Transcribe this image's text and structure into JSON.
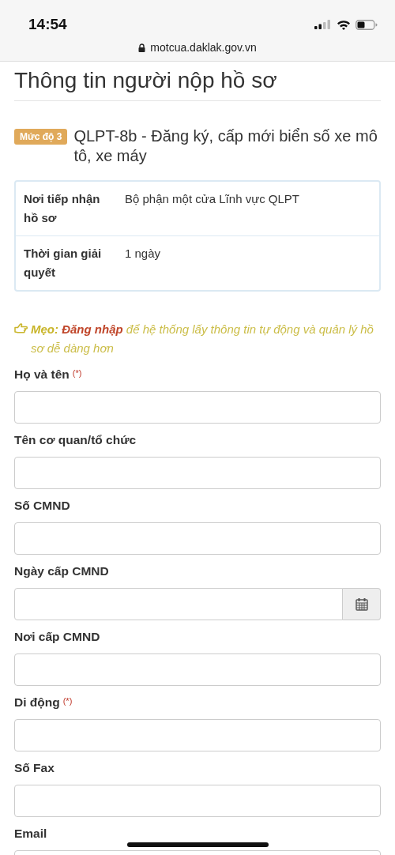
{
  "status_bar": {
    "time": "14:54",
    "url": "motcua.daklak.gov.vn"
  },
  "page_title": "Thông tin người nộp hồ sơ",
  "procedure": {
    "level_badge": "Mức độ 3",
    "title": "QLPT-8b - Đăng ký, cấp mới biển số xe mô tô, xe máy"
  },
  "info_table": [
    {
      "label": "Nơi tiếp nhận hồ sơ",
      "value": "Bộ phận một cửa Lĩnh vực QLPT"
    },
    {
      "label": "Thời gian giải quyết",
      "value": "1 ngày"
    }
  ],
  "tip": {
    "lead": "Mẹo:",
    "link": "Đăng nhập",
    "text": "để hệ thống lấy thông tin tự động và quản lý hồ sơ dễ dàng hơn"
  },
  "fields": [
    {
      "label": "Họ và tên",
      "required_mark": "(*)",
      "kind": "text"
    },
    {
      "label": "Tên cơ quan/tổ chức",
      "kind": "text"
    },
    {
      "label": "Số CMND",
      "kind": "text"
    },
    {
      "label": "Ngày cấp CMND",
      "kind": "date"
    },
    {
      "label": "Nơi cấp CMND",
      "kind": "text"
    },
    {
      "label": "Di động",
      "required_mark": "(*)",
      "kind": "text"
    },
    {
      "label": "Số Fax",
      "kind": "text"
    },
    {
      "label": "Email",
      "kind": "text"
    }
  ]
}
